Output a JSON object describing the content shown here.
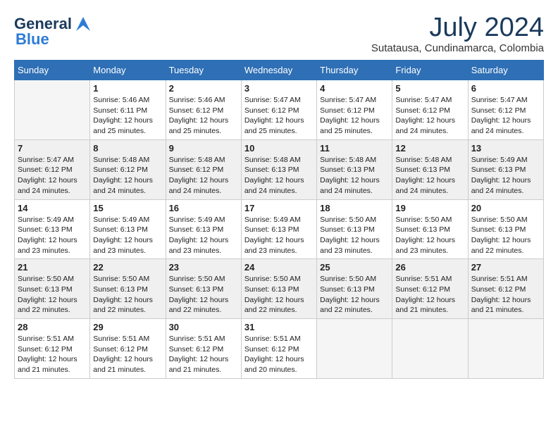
{
  "logo": {
    "general": "General",
    "blue": "Blue"
  },
  "title": "July 2024",
  "location": "Sutatausa, Cundinamarca, Colombia",
  "days_of_week": [
    "Sunday",
    "Monday",
    "Tuesday",
    "Wednesday",
    "Thursday",
    "Friday",
    "Saturday"
  ],
  "weeks": [
    [
      {
        "day": "",
        "empty": true
      },
      {
        "day": "1",
        "sunrise": "Sunrise: 5:46 AM",
        "sunset": "Sunset: 6:11 PM",
        "daylight": "Daylight: 12 hours and 25 minutes."
      },
      {
        "day": "2",
        "sunrise": "Sunrise: 5:46 AM",
        "sunset": "Sunset: 6:12 PM",
        "daylight": "Daylight: 12 hours and 25 minutes."
      },
      {
        "day": "3",
        "sunrise": "Sunrise: 5:47 AM",
        "sunset": "Sunset: 6:12 PM",
        "daylight": "Daylight: 12 hours and 25 minutes."
      },
      {
        "day": "4",
        "sunrise": "Sunrise: 5:47 AM",
        "sunset": "Sunset: 6:12 PM",
        "daylight": "Daylight: 12 hours and 25 minutes."
      },
      {
        "day": "5",
        "sunrise": "Sunrise: 5:47 AM",
        "sunset": "Sunset: 6:12 PM",
        "daylight": "Daylight: 12 hours and 24 minutes."
      },
      {
        "day": "6",
        "sunrise": "Sunrise: 5:47 AM",
        "sunset": "Sunset: 6:12 PM",
        "daylight": "Daylight: 12 hours and 24 minutes."
      }
    ],
    [
      {
        "day": "7",
        "sunrise": "Sunrise: 5:47 AM",
        "sunset": "Sunset: 6:12 PM",
        "daylight": "Daylight: 12 hours and 24 minutes."
      },
      {
        "day": "8",
        "sunrise": "Sunrise: 5:48 AM",
        "sunset": "Sunset: 6:12 PM",
        "daylight": "Daylight: 12 hours and 24 minutes."
      },
      {
        "day": "9",
        "sunrise": "Sunrise: 5:48 AM",
        "sunset": "Sunset: 6:12 PM",
        "daylight": "Daylight: 12 hours and 24 minutes."
      },
      {
        "day": "10",
        "sunrise": "Sunrise: 5:48 AM",
        "sunset": "Sunset: 6:13 PM",
        "daylight": "Daylight: 12 hours and 24 minutes."
      },
      {
        "day": "11",
        "sunrise": "Sunrise: 5:48 AM",
        "sunset": "Sunset: 6:13 PM",
        "daylight": "Daylight: 12 hours and 24 minutes."
      },
      {
        "day": "12",
        "sunrise": "Sunrise: 5:48 AM",
        "sunset": "Sunset: 6:13 PM",
        "daylight": "Daylight: 12 hours and 24 minutes."
      },
      {
        "day": "13",
        "sunrise": "Sunrise: 5:49 AM",
        "sunset": "Sunset: 6:13 PM",
        "daylight": "Daylight: 12 hours and 24 minutes."
      }
    ],
    [
      {
        "day": "14",
        "sunrise": "Sunrise: 5:49 AM",
        "sunset": "Sunset: 6:13 PM",
        "daylight": "Daylight: 12 hours and 23 minutes."
      },
      {
        "day": "15",
        "sunrise": "Sunrise: 5:49 AM",
        "sunset": "Sunset: 6:13 PM",
        "daylight": "Daylight: 12 hours and 23 minutes."
      },
      {
        "day": "16",
        "sunrise": "Sunrise: 5:49 AM",
        "sunset": "Sunset: 6:13 PM",
        "daylight": "Daylight: 12 hours and 23 minutes."
      },
      {
        "day": "17",
        "sunrise": "Sunrise: 5:49 AM",
        "sunset": "Sunset: 6:13 PM",
        "daylight": "Daylight: 12 hours and 23 minutes."
      },
      {
        "day": "18",
        "sunrise": "Sunrise: 5:50 AM",
        "sunset": "Sunset: 6:13 PM",
        "daylight": "Daylight: 12 hours and 23 minutes."
      },
      {
        "day": "19",
        "sunrise": "Sunrise: 5:50 AM",
        "sunset": "Sunset: 6:13 PM",
        "daylight": "Daylight: 12 hours and 23 minutes."
      },
      {
        "day": "20",
        "sunrise": "Sunrise: 5:50 AM",
        "sunset": "Sunset: 6:13 PM",
        "daylight": "Daylight: 12 hours and 22 minutes."
      }
    ],
    [
      {
        "day": "21",
        "sunrise": "Sunrise: 5:50 AM",
        "sunset": "Sunset: 6:13 PM",
        "daylight": "Daylight: 12 hours and 22 minutes."
      },
      {
        "day": "22",
        "sunrise": "Sunrise: 5:50 AM",
        "sunset": "Sunset: 6:13 PM",
        "daylight": "Daylight: 12 hours and 22 minutes."
      },
      {
        "day": "23",
        "sunrise": "Sunrise: 5:50 AM",
        "sunset": "Sunset: 6:13 PM",
        "daylight": "Daylight: 12 hours and 22 minutes."
      },
      {
        "day": "24",
        "sunrise": "Sunrise: 5:50 AM",
        "sunset": "Sunset: 6:13 PM",
        "daylight": "Daylight: 12 hours and 22 minutes."
      },
      {
        "day": "25",
        "sunrise": "Sunrise: 5:50 AM",
        "sunset": "Sunset: 6:13 PM",
        "daylight": "Daylight: 12 hours and 22 minutes."
      },
      {
        "day": "26",
        "sunrise": "Sunrise: 5:51 AM",
        "sunset": "Sunset: 6:12 PM",
        "daylight": "Daylight: 12 hours and 21 minutes."
      },
      {
        "day": "27",
        "sunrise": "Sunrise: 5:51 AM",
        "sunset": "Sunset: 6:12 PM",
        "daylight": "Daylight: 12 hours and 21 minutes."
      }
    ],
    [
      {
        "day": "28",
        "sunrise": "Sunrise: 5:51 AM",
        "sunset": "Sunset: 6:12 PM",
        "daylight": "Daylight: 12 hours and 21 minutes."
      },
      {
        "day": "29",
        "sunrise": "Sunrise: 5:51 AM",
        "sunset": "Sunset: 6:12 PM",
        "daylight": "Daylight: 12 hours and 21 minutes."
      },
      {
        "day": "30",
        "sunrise": "Sunrise: 5:51 AM",
        "sunset": "Sunset: 6:12 PM",
        "daylight": "Daylight: 12 hours and 21 minutes."
      },
      {
        "day": "31",
        "sunrise": "Sunrise: 5:51 AM",
        "sunset": "Sunset: 6:12 PM",
        "daylight": "Daylight: 12 hours and 20 minutes."
      },
      {
        "day": "",
        "empty": true
      },
      {
        "day": "",
        "empty": true
      },
      {
        "day": "",
        "empty": true
      }
    ]
  ]
}
